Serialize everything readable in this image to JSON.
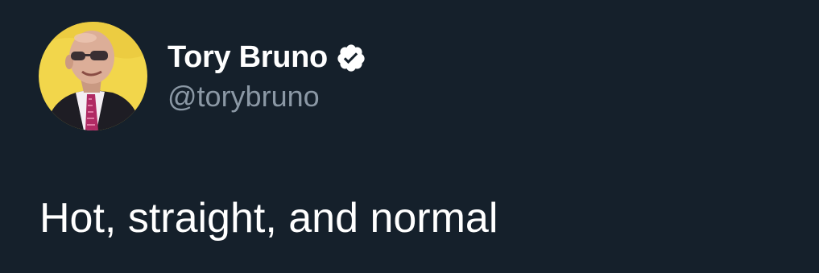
{
  "author": {
    "display_name": "Tory Bruno",
    "handle": "@torybruno",
    "verified": true,
    "avatar_icon": "profile-photo",
    "verified_icon": "verified-badge-icon"
  },
  "tweet": {
    "text": "Hot, straight, and normal"
  },
  "colors": {
    "background": "#15202b",
    "name": "#ffffff",
    "handle": "#8b98a5",
    "text": "#ffffff",
    "avatar_background": "#f2d64b"
  }
}
